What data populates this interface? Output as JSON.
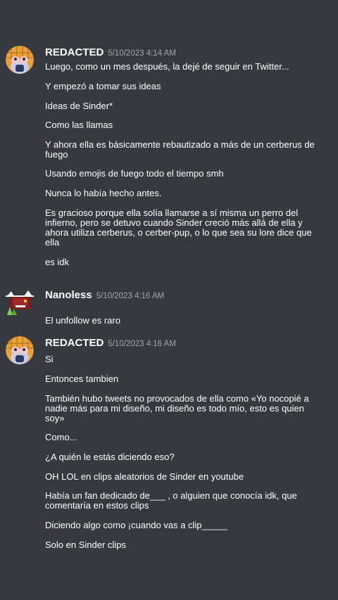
{
  "messages": [
    {
      "username": "REDACTED",
      "timestamp": "5/10/2023 4:14 AM",
      "avatar_icon": "waffle-character-avatar",
      "lines": [
        "Luego, como un mes después, la dejé de seguir en Twitter...",
        "Y empezó a tomar sus ideas",
        "Ideas de Sinder*",
        "Como las llamas",
        "Y ahora ella es básicamente rebautizado a más de un cerberus de fuego",
        "Usando emojis de fuego todo el tiempo smh",
        "Nunca lo había hecho antes.",
        "Es gracioso porque ella solía llamarse a sí misma un perro del infierno, pero se detuvo cuando Sinder creció más allá de ella y ahora utiliza cerberus, o cerber-pup, o lo que sea su lore dice que ella",
        "es idk"
      ]
    },
    {
      "username": "Nanoless",
      "timestamp": "5/10/2023 4:16 AM",
      "avatar_icon": "pixel-dragon-avatar",
      "lines": [
        "El unfollow es raro"
      ]
    },
    {
      "username": "REDACTED",
      "timestamp": "5/10/2023 4:16 AM",
      "avatar_icon": "waffle-character-avatar",
      "lines": [
        "Si",
        "Entonces tambien",
        "También hubo tweets no provocados de ella como «Yo nocopié a nadie más para mi diseño, mi diseño es todo mío, esto es quien soy»",
        "Como...",
        "¿A quién le estás diciendo eso?",
        "OH LOL en clips aleatorios de Sinder en youtube",
        "Había un fan dedicado de___ , o alguien que conocía idk, que comentaría en estos clips",
        "Diciendo algo como ¡cuando vas a clip_____",
        "Solo en Sinder clips"
      ]
    }
  ]
}
